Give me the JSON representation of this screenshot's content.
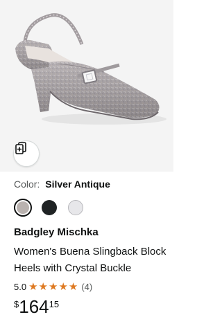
{
  "product": {
    "image_alt": "Silver glitter slingback block heel shoe with crystal buckle",
    "compare_icon": "compare-cards-icon",
    "color_label": "Color:",
    "color_value": "Silver Antique",
    "swatches": [
      {
        "name": "Silver Antique",
        "color": "#b9b2af",
        "selected": true
      },
      {
        "name": "Black",
        "color": "#1f2324",
        "selected": false
      },
      {
        "name": "White",
        "color": "#e7e7ea",
        "selected": false
      }
    ],
    "brand": "Badgley Mischka",
    "title": "Women's Buena Slingback Block Heels with Crystal Buckle",
    "rating": {
      "value": "5.0",
      "stars": 5,
      "count": "(4)",
      "star_color": "#de7921"
    },
    "price": {
      "symbol": "$",
      "whole": "164",
      "fraction": "15"
    }
  }
}
